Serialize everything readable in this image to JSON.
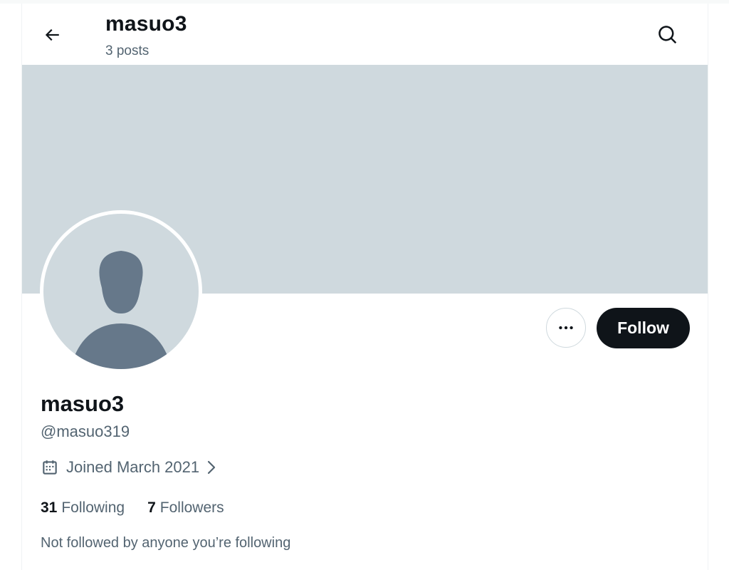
{
  "header": {
    "title": "masuo3",
    "subtitle": "3 posts",
    "back_icon": "arrow-left-icon",
    "search_icon": "search-icon"
  },
  "profile": {
    "display_name": "masuo3",
    "handle": "@masuo319",
    "joined": "Joined March 2021",
    "following_count": "31",
    "following_label": "Following",
    "followers_count": "7",
    "followers_label": "Followers",
    "mutuals_note": "Not followed by anyone you’re following"
  },
  "actions": {
    "more_icon": "more-horizontal-icon",
    "follow_label": "Follow"
  },
  "colors": {
    "banner": "#cfd9de",
    "text_primary": "#0f1419",
    "text_secondary": "#536471",
    "follow_bg": "#0f1419",
    "avatar_bg": "#cfd9de",
    "avatar_figure": "#66788a"
  }
}
